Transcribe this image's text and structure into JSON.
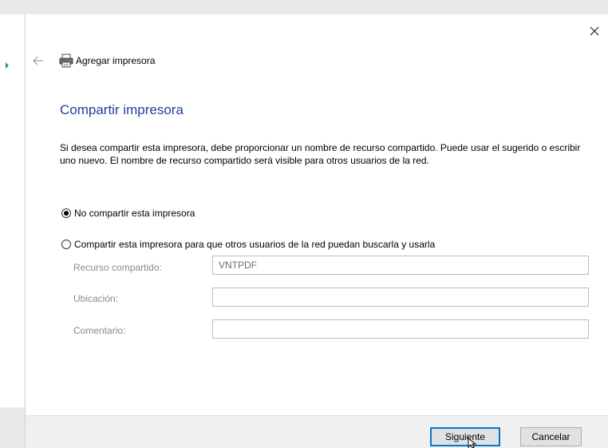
{
  "window": {
    "title": "Agregar impresora"
  },
  "page": {
    "heading": "Compartir impresora",
    "description": "Si desea compartir esta impresora, debe proporcionar un nombre de recurso compartido. Puede usar el sugerido o escribir uno nuevo. El nombre de recurso compartido será visible para otros usuarios de la red."
  },
  "options": {
    "no_share": {
      "label": "No compartir esta impresora",
      "selected": true
    },
    "share": {
      "label": "Compartir esta impresora para que otros usuarios de la red puedan buscarla y usarla",
      "selected": false
    }
  },
  "fields": {
    "share_name": {
      "label": "Recurso compartido:",
      "value": "VNTPDF"
    },
    "location": {
      "label": "Ubicación:",
      "value": ""
    },
    "comment": {
      "label": "Comentario:",
      "value": ""
    }
  },
  "buttons": {
    "next": "Siguiente",
    "cancel": "Cancelar"
  },
  "icons": {
    "close": "close-icon",
    "back": "back-arrow-icon",
    "printer": "printer-icon",
    "cursor": "mouse-cursor-icon"
  },
  "colors": {
    "heading": "#1e3f9c",
    "primary_border": "#0078d7"
  }
}
